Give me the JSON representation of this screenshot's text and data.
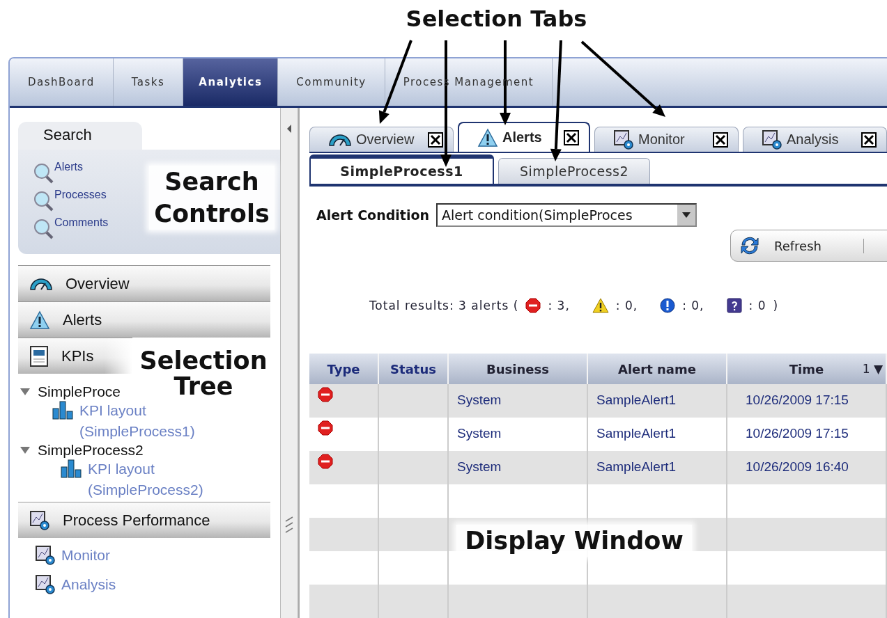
{
  "annotations": {
    "title": "Selection Tabs",
    "search_controls": "Search Controls",
    "selection_tree": "Selection Tree",
    "display_window": "Display Window"
  },
  "nav_tabs": [
    {
      "label": "DashBoard",
      "selected": false
    },
    {
      "label": "Tasks",
      "selected": false
    },
    {
      "label": "Analytics",
      "selected": true
    },
    {
      "label": "Community",
      "selected": false
    },
    {
      "label": "Process Management",
      "selected": false
    }
  ],
  "search_panel": {
    "tab": "Search",
    "links": [
      "Alerts",
      "Processes",
      "Comments"
    ]
  },
  "sidebar": {
    "sections": [
      {
        "kind": "overview",
        "label": "Overview"
      },
      {
        "kind": "alerts",
        "label": "Alerts"
      },
      {
        "kind": "kpis",
        "label": "KPIs"
      }
    ],
    "tree": [
      {
        "label": "SimpleProce",
        "expanded": true,
        "children": [
          {
            "label": "KPI layout (SimpleProcess1)"
          }
        ]
      },
      {
        "label": "SimpleProcess2",
        "expanded": true,
        "children": [
          {
            "label": "KPI layout (SimpleProcess2)"
          }
        ]
      }
    ],
    "performance": {
      "label": "Process Performance",
      "items": [
        "Monitor",
        "Analysis"
      ]
    }
  },
  "doc_tabs": [
    {
      "kind": "overview",
      "label": "Overview",
      "selected": false
    },
    {
      "kind": "alerts",
      "label": "Alerts",
      "selected": true
    },
    {
      "kind": "monitor",
      "label": "Monitor",
      "selected": false
    },
    {
      "kind": "monitor",
      "label": "Analysis",
      "selected": false
    }
  ],
  "sub_tabs": [
    {
      "label": "SimpleProcess1",
      "selected": true
    },
    {
      "label": "SimpleProcess2",
      "selected": false
    }
  ],
  "filter": {
    "label": "Alert Condition",
    "value": "Alert condition(SimpleProces"
  },
  "toolbar": {
    "refresh": "Refresh"
  },
  "summary": {
    "prefix": "Total results: 3 alerts (",
    "counts": [
      {
        "kind": "stop",
        "count": ": 3,"
      },
      {
        "kind": "warning",
        "count": ": 0,"
      },
      {
        "kind": "info",
        "count": ": 0,"
      },
      {
        "kind": "unknown",
        "count": ": 0"
      }
    ],
    "suffix": ")"
  },
  "table": {
    "columns": [
      "Type",
      "Status",
      "Business",
      "Alert name",
      "Time"
    ],
    "sort_indicator": "1 ▼",
    "rows": [
      {
        "kind": "stop",
        "business": "System",
        "alert_name": "SampleAlert1",
        "time": "10/26/2009 17:15"
      },
      {
        "kind": "stop",
        "business": "System",
        "alert_name": "SampleAlert1",
        "time": "10/26/2009 17:15"
      },
      {
        "kind": "stop",
        "business": "System",
        "alert_name": "SampleAlert1",
        "time": "10/26/2009 16:40"
      }
    ]
  }
}
